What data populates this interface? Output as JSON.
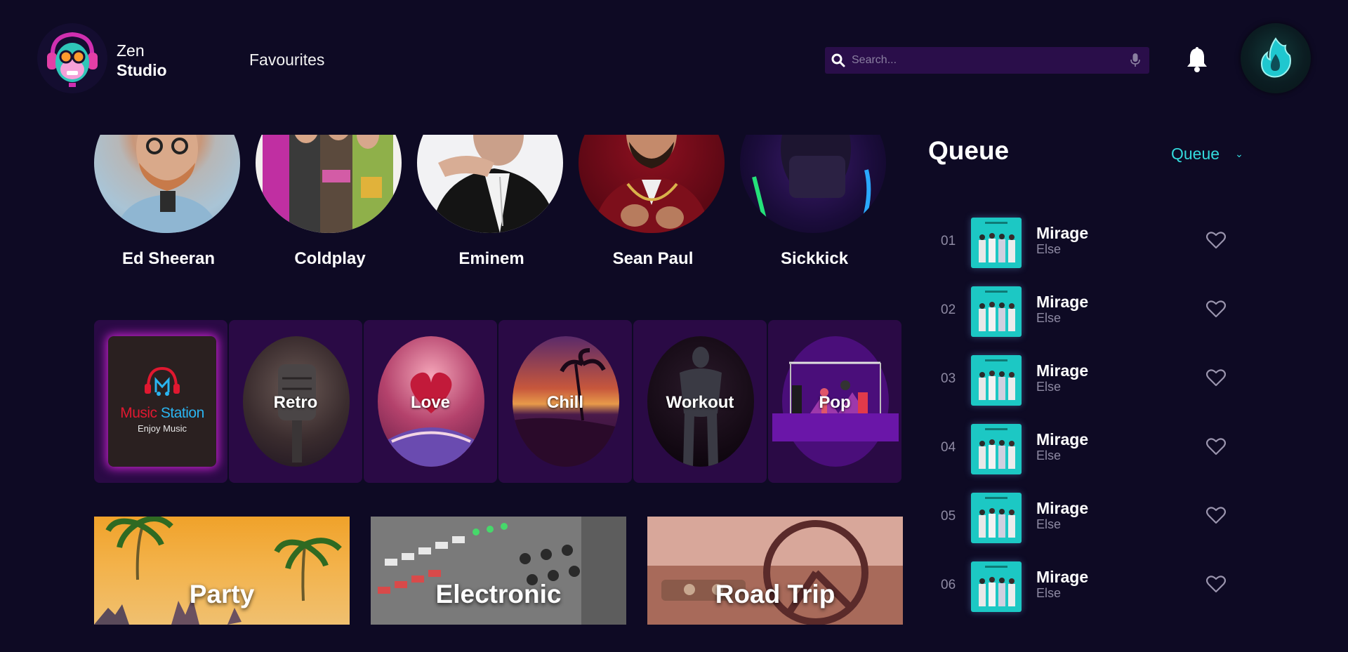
{
  "brand": {
    "line1": "Zen",
    "line2": "Studio"
  },
  "nav": {
    "favourites": "Favourites"
  },
  "search": {
    "placeholder": "Search..."
  },
  "artists": [
    {
      "name": "Ed Sheeran"
    },
    {
      "name": "Coldplay"
    },
    {
      "name": "Eminem"
    },
    {
      "name": "Sean Paul"
    },
    {
      "name": "Sickkick"
    }
  ],
  "moods": {
    "station": {
      "line1a": "Music",
      "line1b": "Station",
      "line2": "Enjoy Music"
    },
    "items": [
      {
        "label": "Retro"
      },
      {
        "label": "Love"
      },
      {
        "label": "Chill"
      },
      {
        "label": "Workout"
      },
      {
        "label": "Pop"
      }
    ]
  },
  "genres": [
    {
      "label": "Party"
    },
    {
      "label": "Electronic"
    },
    {
      "label": "Road Trip"
    }
  ],
  "queue": {
    "title": "Queue",
    "select_value": "Queue",
    "items": [
      {
        "num": "01",
        "title": "Mirage",
        "artist": "Else"
      },
      {
        "num": "02",
        "title": "Mirage",
        "artist": "Else"
      },
      {
        "num": "03",
        "title": "Mirage",
        "artist": "Else"
      },
      {
        "num": "04",
        "title": "Mirage",
        "artist": "Else"
      },
      {
        "num": "05",
        "title": "Mirage",
        "artist": "Else"
      },
      {
        "num": "06",
        "title": "Mirage",
        "artist": "Else"
      }
    ]
  },
  "colors": {
    "background": "#0e0a24",
    "accent": "#33d9dc",
    "panel": "#2a0a45",
    "search_bg": "#2a0e4a",
    "muted_text": "#8e8aa3"
  },
  "icons": {
    "search": "search-icon",
    "mic": "mic-icon",
    "bell": "bell-icon",
    "heart": "heart-icon",
    "chevron": "chevron-down-icon"
  }
}
